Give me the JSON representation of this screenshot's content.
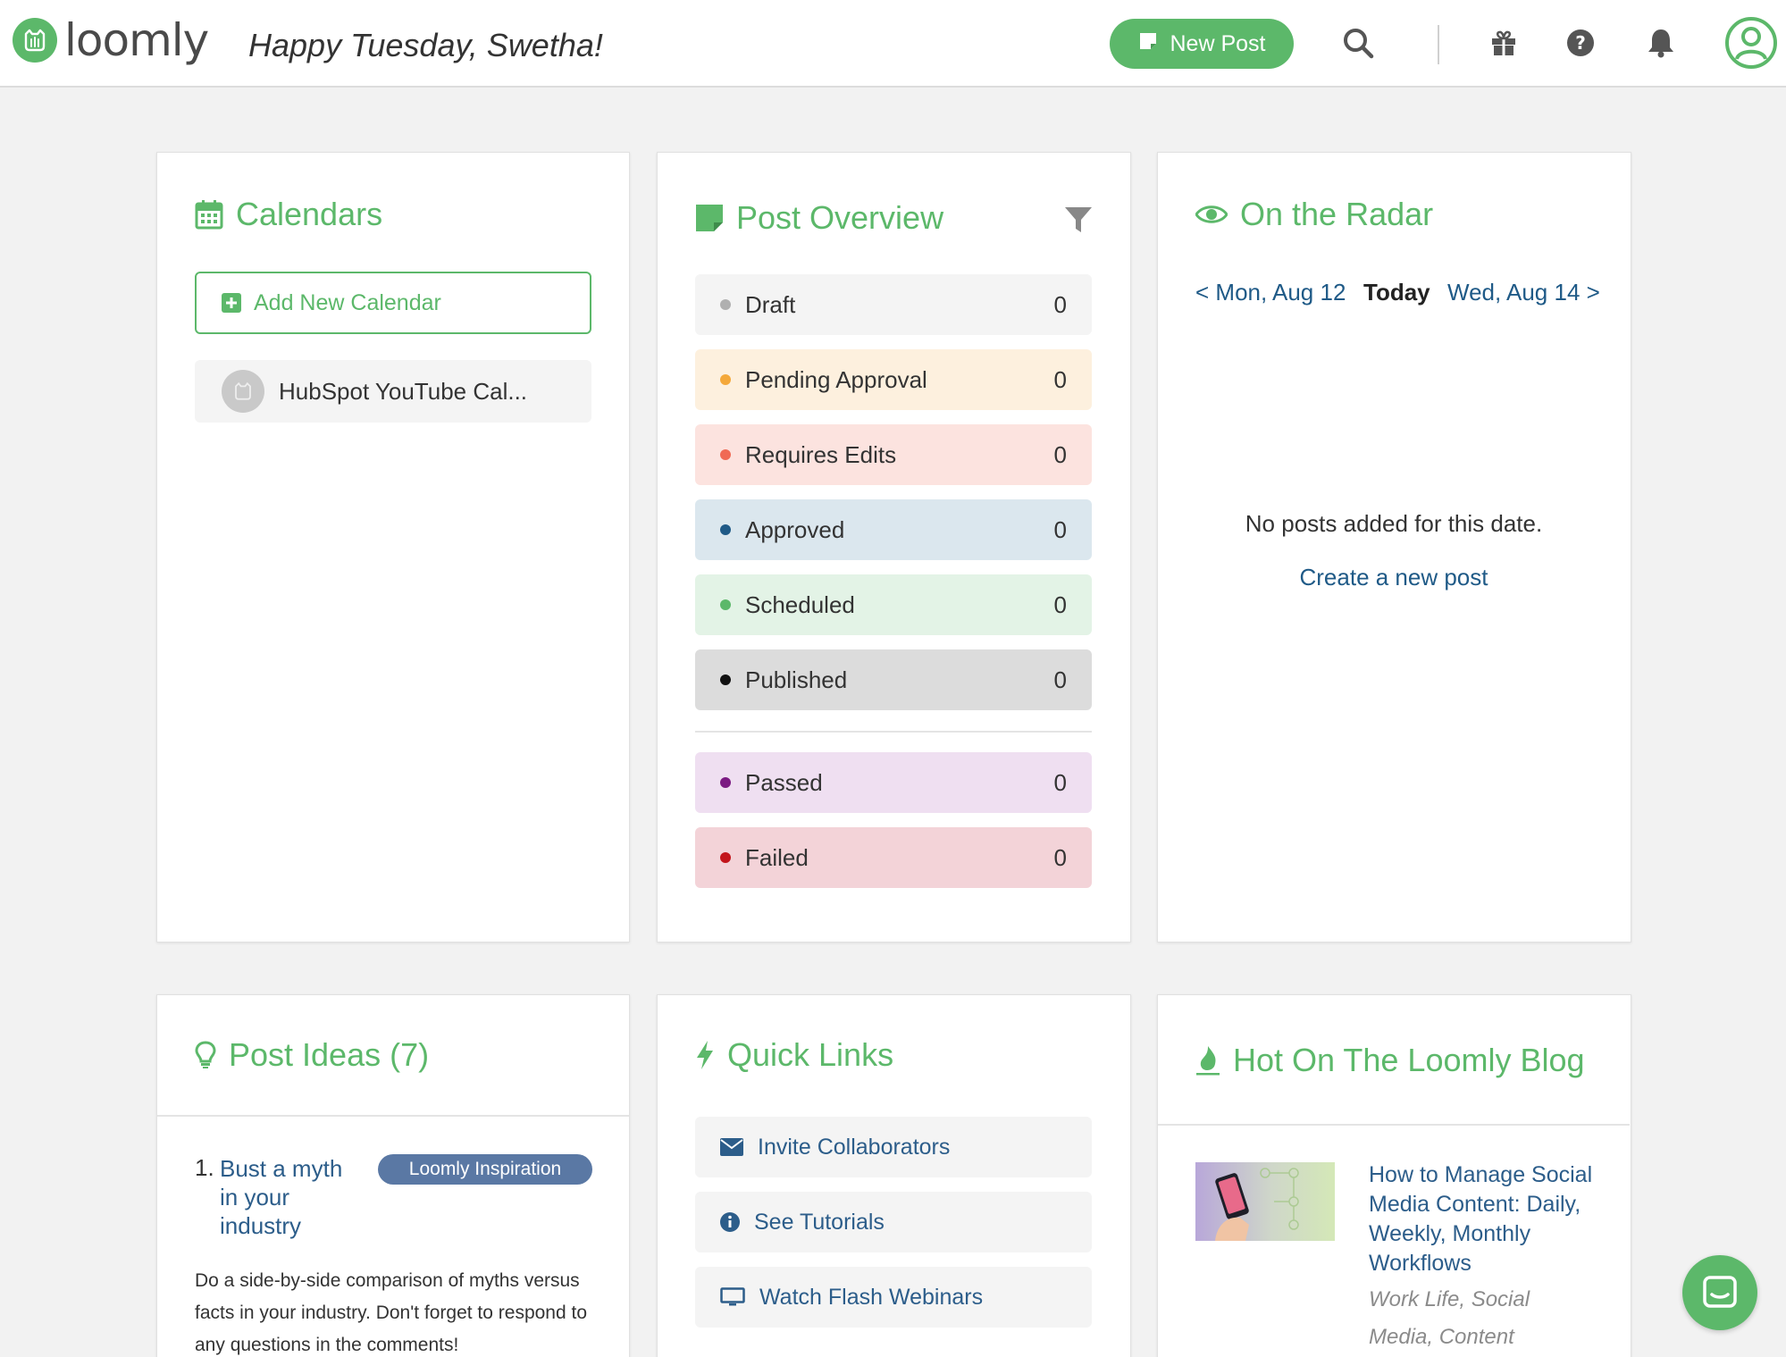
{
  "header": {
    "logo_text": "loomly",
    "greeting": "Happy Tuesday, Swetha!",
    "new_post_label": "New Post",
    "icons": [
      "search-icon",
      "gift-icon",
      "help-icon",
      "bell-icon",
      "user-avatar-icon"
    ]
  },
  "colors": {
    "brand_green": "#5cb86a",
    "link_blue": "#2c5d8a",
    "background": "#f2f2f2"
  },
  "calendars": {
    "title": "Calendars",
    "add_label": "Add New Calendar",
    "items": [
      {
        "label": "HubSpot YouTube Cal..."
      }
    ]
  },
  "post_overview": {
    "title": "Post Overview",
    "statuses": [
      {
        "label": "Draft",
        "count": "0",
        "dot": "#b0b0b0",
        "bg": "#f4f4f4"
      },
      {
        "label": "Pending Approval",
        "count": "0",
        "dot": "#f4a83a",
        "bg": "#fdf0de"
      },
      {
        "label": "Requires Edits",
        "count": "0",
        "dot": "#f06a55",
        "bg": "#fce3df"
      },
      {
        "label": "Approved",
        "count": "0",
        "dot": "#1f5a87",
        "bg": "#dbe7ee"
      },
      {
        "label": "Scheduled",
        "count": "0",
        "dot": "#5cb86a",
        "bg": "#e3f3e6"
      },
      {
        "label": "Published",
        "count": "0",
        "dot": "#111111",
        "bg": "#dcdcdc"
      },
      {
        "label": "Passed",
        "count": "0",
        "dot": "#7b1a82",
        "bg": "#efdff1"
      },
      {
        "label": "Failed",
        "count": "0",
        "dot": "#c3151b",
        "bg": "#f3d3d8"
      }
    ]
  },
  "radar": {
    "title": "On the Radar",
    "prev": "< Mon, Aug 12",
    "today": "Today",
    "next": "Wed, Aug 14 >",
    "empty_message": "No posts added for this date.",
    "create_link": "Create a new post"
  },
  "post_ideas": {
    "title": "Post Ideas (7)",
    "items": [
      {
        "number": "1.",
        "title": "Bust a myth in your industry",
        "badge": "Loomly Inspiration",
        "description": "Do a side-by-side comparison of myths versus facts in your industry. Don't forget to respond to any questions in the comments!"
      }
    ]
  },
  "quick_links": {
    "title": "Quick Links",
    "items": [
      {
        "label": "Invite Collaborators",
        "icon": "envelope-icon"
      },
      {
        "label": "See Tutorials",
        "icon": "info-icon"
      },
      {
        "label": "Watch Flash Webinars",
        "icon": "monitor-icon"
      }
    ]
  },
  "blog": {
    "title": "Hot On The Loomly Blog",
    "post_title": "How to Manage Social Media Content: Daily, Weekly, Monthly Workflows",
    "tags": "Work Life, Social Media, Content"
  }
}
